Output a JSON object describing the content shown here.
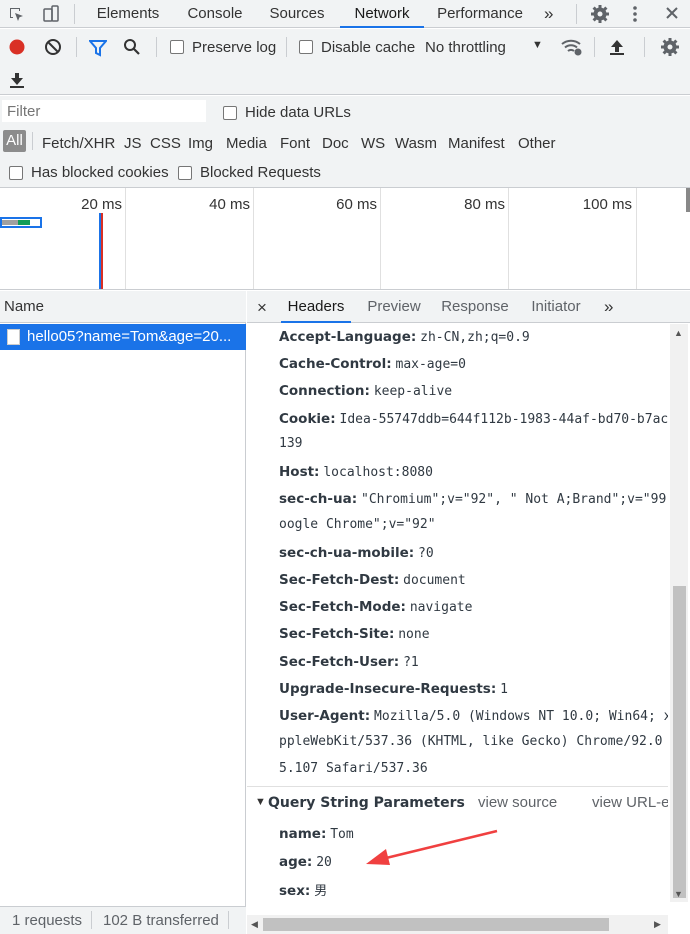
{
  "top_tabs": [
    {
      "label": "Elements"
    },
    {
      "label": "Console"
    },
    {
      "label": "Sources"
    },
    {
      "label": "Network"
    },
    {
      "label": "Performance"
    }
  ],
  "more_tabs_glyph": "»",
  "toolbar": {
    "preserve_log": "Preserve log",
    "disable_cache": "Disable cache",
    "throttling": "No throttling"
  },
  "filter": {
    "placeholder": "Filter",
    "hide_data_urls": "Hide data URLs",
    "types": [
      "All",
      "Fetch/XHR",
      "JS",
      "CSS",
      "Img",
      "Media",
      "Font",
      "Doc",
      "WS",
      "Wasm",
      "Manifest",
      "Other"
    ],
    "has_blocked_cookies": "Has blocked cookies",
    "blocked_requests": "Blocked Requests"
  },
  "overview": {
    "ticks": [
      "20 ms",
      "40 ms",
      "60 ms",
      "80 ms",
      "100 ms"
    ]
  },
  "requests": {
    "column_name": "Name",
    "rows": [
      {
        "name": "hello05?name=Tom&age=20..."
      }
    ]
  },
  "detail": {
    "close_glyph": "×",
    "tabs": [
      "Headers",
      "Preview",
      "Response",
      "Initiator"
    ],
    "more_glyph": "»",
    "request_headers": [
      {
        "name": "Accept-Language:",
        "value": "zh-CN,zh;q=0.9"
      },
      {
        "name": "Cache-Control:",
        "value": "max-age=0"
      },
      {
        "name": "Connection:",
        "value": "keep-alive"
      },
      {
        "name": "Cookie:",
        "value": "Idea-55747ddb=644f112b-1983-44af-bd70-b7ac",
        "cont": "139"
      },
      {
        "name": "Host:",
        "value": "localhost:8080"
      },
      {
        "name": "sec-ch-ua:",
        "value": "\"Chromium\";v=\"92\", \" Not A;Brand\";v=\"99",
        "cont": "oogle Chrome\";v=\"92\""
      },
      {
        "name": "sec-ch-ua-mobile:",
        "value": "?0"
      },
      {
        "name": "Sec-Fetch-Dest:",
        "value": "document"
      },
      {
        "name": "Sec-Fetch-Mode:",
        "value": "navigate"
      },
      {
        "name": "Sec-Fetch-Site:",
        "value": "none"
      },
      {
        "name": "Sec-Fetch-User:",
        "value": "?1"
      },
      {
        "name": "Upgrade-Insecure-Requests:",
        "value": "1"
      },
      {
        "name": "User-Agent:",
        "value": "Mozilla/5.0 (Windows NT 10.0; Win64; x",
        "cont": "ppleWebKit/537.36 (KHTML, like Gecko) Chrome/92.0",
        "cont2": "5.107 Safari/537.36"
      }
    ],
    "query_section": {
      "title": "Query String Parameters",
      "view_source": "view source",
      "view_url_encoded": "view URL-en",
      "params": [
        {
          "name": "name:",
          "value": "Tom"
        },
        {
          "name": "age:",
          "value": "20"
        },
        {
          "name": "sex:",
          "value": "男"
        }
      ]
    }
  },
  "status": {
    "requests": "1 requests",
    "transferred": "102 B transferred"
  },
  "colors": {
    "accent": "#1a73e8",
    "record": "#d93025",
    "annotation_arrow": "#f04040"
  }
}
